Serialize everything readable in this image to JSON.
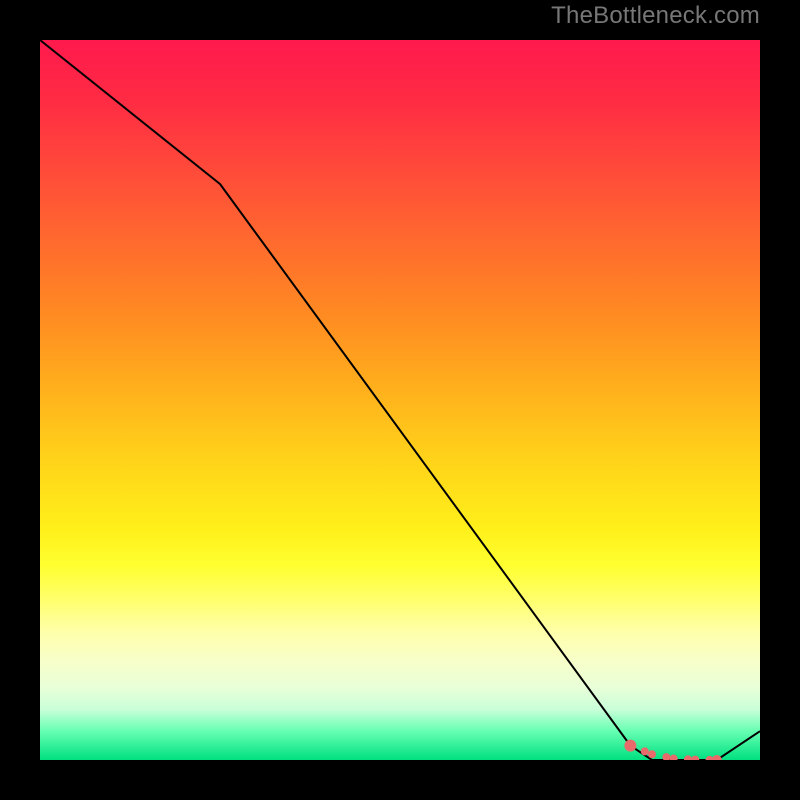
{
  "attribution": "TheBottleneck.com",
  "chart_data": {
    "type": "line",
    "title": "",
    "xlabel": "",
    "ylabel": "",
    "ylim": [
      0,
      100
    ],
    "xlim": [
      0,
      100
    ],
    "series": [
      {
        "name": "bottleneck-curve",
        "x": [
          0,
          25,
          82,
          85,
          94,
          100
        ],
        "values": [
          100,
          80,
          2,
          0,
          0,
          4
        ]
      }
    ],
    "markers": {
      "name": "highlight-dots",
      "color": "#e86a6a",
      "points_x": [
        82,
        84,
        85,
        87,
        88,
        90,
        91,
        93,
        94
      ],
      "points_y": [
        2,
        1.2,
        0.8,
        0.4,
        0.2,
        0.1,
        0.05,
        0.02,
        0
      ]
    },
    "gradient_stops": [
      {
        "pos": 0,
        "color": "#ff1a4d"
      },
      {
        "pos": 50,
        "color": "#ffd21a"
      },
      {
        "pos": 75,
        "color": "#ffff30"
      },
      {
        "pos": 100,
        "color": "#00e080"
      }
    ]
  }
}
